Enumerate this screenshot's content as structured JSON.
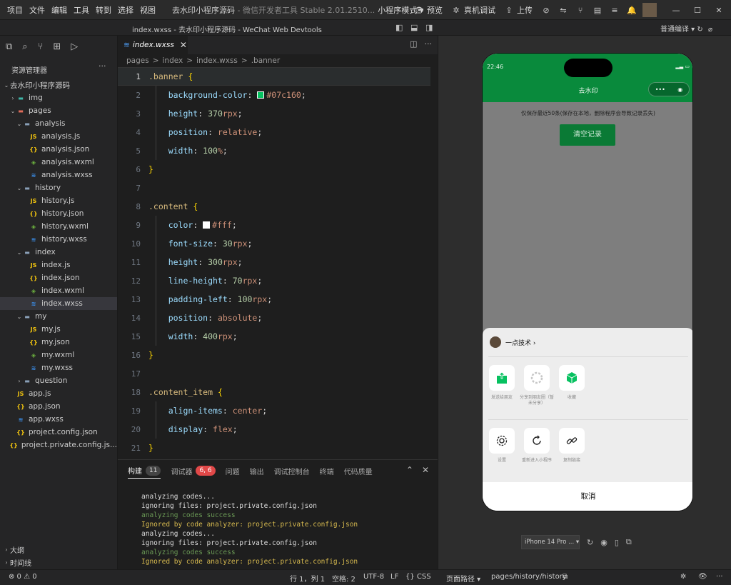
{
  "menus": [
    "项目",
    "文件",
    "编辑",
    "工具",
    "转到",
    "选择",
    "视图"
  ],
  "title_main": "去水印小程序源码",
  "title_sub": "- 微信开发者工具 Stable 2.01.2510...",
  "mode": "小程序模式 ▾",
  "toolbar": {
    "preview": "预览",
    "realdebug": "真机调试",
    "upload": "上传"
  },
  "window_title": "index.wxss - 去水印小程序源码 - WeChat Web Devtools",
  "sim_compile": "普通编译 ▾",
  "sidebar": {
    "header": "资源管理器",
    "more": "···",
    "root": "去水印小程序源码",
    "tree": [
      {
        "label": "img",
        "depth": 1,
        "type": "folder",
        "open": false
      },
      {
        "label": "pages",
        "depth": 1,
        "type": "folder",
        "open": true
      },
      {
        "label": "analysis",
        "depth": 2,
        "type": "folder",
        "open": true
      },
      {
        "label": "analysis.js",
        "depth": 3,
        "type": "js"
      },
      {
        "label": "analysis.json",
        "depth": 3,
        "type": "json"
      },
      {
        "label": "analysis.wxml",
        "depth": 3,
        "type": "wxml"
      },
      {
        "label": "analysis.wxss",
        "depth": 3,
        "type": "wxss"
      },
      {
        "label": "history",
        "depth": 2,
        "type": "folder",
        "open": true
      },
      {
        "label": "history.js",
        "depth": 3,
        "type": "js"
      },
      {
        "label": "history.json",
        "depth": 3,
        "type": "json"
      },
      {
        "label": "history.wxml",
        "depth": 3,
        "type": "wxml"
      },
      {
        "label": "history.wxss",
        "depth": 3,
        "type": "wxss"
      },
      {
        "label": "index",
        "depth": 2,
        "type": "folder",
        "open": true
      },
      {
        "label": "index.js",
        "depth": 3,
        "type": "js"
      },
      {
        "label": "index.json",
        "depth": 3,
        "type": "json"
      },
      {
        "label": "index.wxml",
        "depth": 3,
        "type": "wxml"
      },
      {
        "label": "index.wxss",
        "depth": 3,
        "type": "wxss",
        "selected": true
      },
      {
        "label": "my",
        "depth": 2,
        "type": "folder",
        "open": true
      },
      {
        "label": "my.js",
        "depth": 3,
        "type": "js"
      },
      {
        "label": "my.json",
        "depth": 3,
        "type": "json"
      },
      {
        "label": "my.wxml",
        "depth": 3,
        "type": "wxml"
      },
      {
        "label": "my.wxss",
        "depth": 3,
        "type": "wxss"
      },
      {
        "label": "question",
        "depth": 2,
        "type": "folder",
        "open": false
      },
      {
        "label": "app.js",
        "depth": 1,
        "type": "js"
      },
      {
        "label": "app.json",
        "depth": 1,
        "type": "json"
      },
      {
        "label": "app.wxss",
        "depth": 1,
        "type": "wxss"
      },
      {
        "label": "project.config.json",
        "depth": 1,
        "type": "json"
      },
      {
        "label": "project.private.config.js...",
        "depth": 1,
        "type": "json"
      }
    ],
    "outline": "大纲",
    "timeline": "时间线"
  },
  "editor": {
    "tab": "index.wxss",
    "breadcrumb": [
      "pages",
      ">",
      "index",
      ">",
      "index.wxss",
      ">",
      ".banner"
    ],
    "lines": [
      {
        "n": "1",
        "parts": [
          [
            "sel-c",
            ".banner"
          ],
          [
            "unit",
            " "
          ],
          [
            "brace",
            "{"
          ]
        ]
      },
      {
        "n": "2",
        "parts": [
          [
            "prop",
            "    background-color"
          ],
          [
            "unit",
            ": "
          ],
          [
            "swatch",
            "#07c160"
          ],
          [
            "val",
            "#07c160"
          ],
          [
            "unit",
            ";"
          ]
        ]
      },
      {
        "n": "3",
        "parts": [
          [
            "prop",
            "    height"
          ],
          [
            "unit",
            ": "
          ],
          [
            "num",
            "370"
          ],
          [
            "val",
            "rpx"
          ],
          [
            "unit",
            ";"
          ]
        ]
      },
      {
        "n": "4",
        "parts": [
          [
            "prop",
            "    position"
          ],
          [
            "unit",
            ": "
          ],
          [
            "val",
            "relative"
          ],
          [
            "unit",
            ";"
          ]
        ]
      },
      {
        "n": "5",
        "parts": [
          [
            "prop",
            "    width"
          ],
          [
            "unit",
            ": "
          ],
          [
            "num",
            "100"
          ],
          [
            "val",
            "%"
          ],
          [
            "unit",
            ";"
          ]
        ]
      },
      {
        "n": "6",
        "parts": [
          [
            "brace",
            "}"
          ]
        ]
      },
      {
        "n": "7",
        "parts": []
      },
      {
        "n": "8",
        "parts": [
          [
            "sel-c",
            ".content"
          ],
          [
            "unit",
            " "
          ],
          [
            "brace",
            "{"
          ]
        ]
      },
      {
        "n": "9",
        "parts": [
          [
            "prop",
            "    color"
          ],
          [
            "unit",
            ": "
          ],
          [
            "swatch",
            "#fff"
          ],
          [
            "val",
            "#fff"
          ],
          [
            "unit",
            ";"
          ]
        ]
      },
      {
        "n": "10",
        "parts": [
          [
            "prop",
            "    font-size"
          ],
          [
            "unit",
            ": "
          ],
          [
            "num",
            "30"
          ],
          [
            "val",
            "rpx"
          ],
          [
            "unit",
            ";"
          ]
        ]
      },
      {
        "n": "11",
        "parts": [
          [
            "prop",
            "    height"
          ],
          [
            "unit",
            ": "
          ],
          [
            "num",
            "300"
          ],
          [
            "val",
            "rpx"
          ],
          [
            "unit",
            ";"
          ]
        ]
      },
      {
        "n": "12",
        "parts": [
          [
            "prop",
            "    line-height"
          ],
          [
            "unit",
            ": "
          ],
          [
            "num",
            "70"
          ],
          [
            "val",
            "rpx"
          ],
          [
            "unit",
            ";"
          ]
        ]
      },
      {
        "n": "13",
        "parts": [
          [
            "prop",
            "    padding-left"
          ],
          [
            "unit",
            ": "
          ],
          [
            "num",
            "100"
          ],
          [
            "val",
            "rpx"
          ],
          [
            "unit",
            ";"
          ]
        ]
      },
      {
        "n": "14",
        "parts": [
          [
            "prop",
            "    position"
          ],
          [
            "unit",
            ": "
          ],
          [
            "val",
            "absolute"
          ],
          [
            "unit",
            ";"
          ]
        ]
      },
      {
        "n": "15",
        "parts": [
          [
            "prop",
            "    width"
          ],
          [
            "unit",
            ": "
          ],
          [
            "num",
            "400"
          ],
          [
            "val",
            "rpx"
          ],
          [
            "unit",
            ";"
          ]
        ]
      },
      {
        "n": "16",
        "parts": [
          [
            "brace",
            "}"
          ]
        ]
      },
      {
        "n": "17",
        "parts": []
      },
      {
        "n": "18",
        "parts": [
          [
            "sel-c",
            ".content_item"
          ],
          [
            "unit",
            " "
          ],
          [
            "brace",
            "{"
          ]
        ]
      },
      {
        "n": "19",
        "parts": [
          [
            "prop",
            "    align-items"
          ],
          [
            "unit",
            ": "
          ],
          [
            "val",
            "center"
          ],
          [
            "unit",
            ";"
          ]
        ]
      },
      {
        "n": "20",
        "parts": [
          [
            "prop",
            "    display"
          ],
          [
            "unit",
            ": "
          ],
          [
            "val",
            "flex"
          ],
          [
            "unit",
            ";"
          ]
        ]
      },
      {
        "n": "21",
        "parts": [
          [
            "brace",
            "}"
          ]
        ]
      }
    ]
  },
  "panel": {
    "tabs": [
      {
        "label": "构建",
        "badge": "11",
        "active": true
      },
      {
        "label": "调试器",
        "badge": "6, 6",
        "red": true
      },
      {
        "label": "问题"
      },
      {
        "label": "输出"
      },
      {
        "label": "调试控制台"
      },
      {
        "label": "终端"
      },
      {
        "label": "代码质量"
      }
    ],
    "log": [
      {
        "c": "w",
        "t": "analyzing codes..."
      },
      {
        "c": "w",
        "t": "ignoring files: project.private.config.json"
      },
      {
        "c": "g",
        "t": "analyzing codes success"
      },
      {
        "c": "y",
        "t": "Ignored by code analyzer: project.private.config.json"
      },
      {
        "c": "w",
        "t": "analyzing codes..."
      },
      {
        "c": "w",
        "t": "ignoring files: project.private.config.json"
      },
      {
        "c": "g",
        "t": "analyzing codes success"
      },
      {
        "c": "y",
        "t": "Ignored by code analyzer: project.private.config.json"
      }
    ]
  },
  "status": {
    "problems": "⊗ 0 ⚠ 0",
    "pos": "行 1，列 1",
    "spaces": "空格: 2",
    "enc": "UTF-8",
    "eol": "LF",
    "lang": "{} CSS"
  },
  "phone": {
    "time": "22:46",
    "nav_title": "去水印",
    "notice": "仅保存最近50条(保存在本地，删除程序会导致记录丢失)",
    "clear_btn": "清空记录",
    "sheet_title": "一点技术 ›",
    "row1": [
      "发送给朋友",
      "分享到朋友圈（暂未分享）",
      "收藏"
    ],
    "row2": [
      "设置",
      "重新进入小程序",
      "复制链接"
    ],
    "cancel": "取消"
  },
  "device": "iPhone 14 Pro ... ▾",
  "sim_status": {
    "path_label": "页面路径 ▾",
    "path": "pages/history/history"
  },
  "colors": {
    "accent": "#07c160",
    "phone_header": "#098a3c"
  }
}
